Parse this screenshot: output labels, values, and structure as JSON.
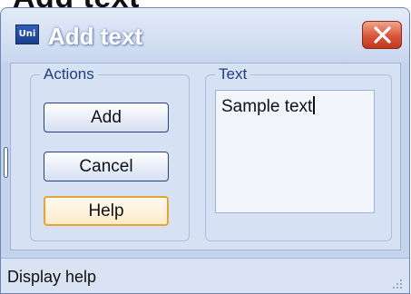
{
  "background_title": "Add text",
  "window": {
    "app_icon_text": "Uni",
    "title": "Add text",
    "close_icon": "close-x-icon"
  },
  "actions_group": {
    "label": "Actions",
    "buttons": {
      "add": "Add",
      "cancel": "Cancel",
      "help": "Help"
    },
    "focused_button": "help"
  },
  "text_group": {
    "label": "Text",
    "value": "Sample text"
  },
  "status_bar": {
    "text": "Display help",
    "grip_icon": "resize-grip-icon"
  },
  "colors": {
    "window_frame": "#c5d4ed",
    "client_background": "#d6e1f4",
    "group_label": "#1f3f7d",
    "close_button": "#d9553a",
    "focus_border": "#e5a434"
  }
}
